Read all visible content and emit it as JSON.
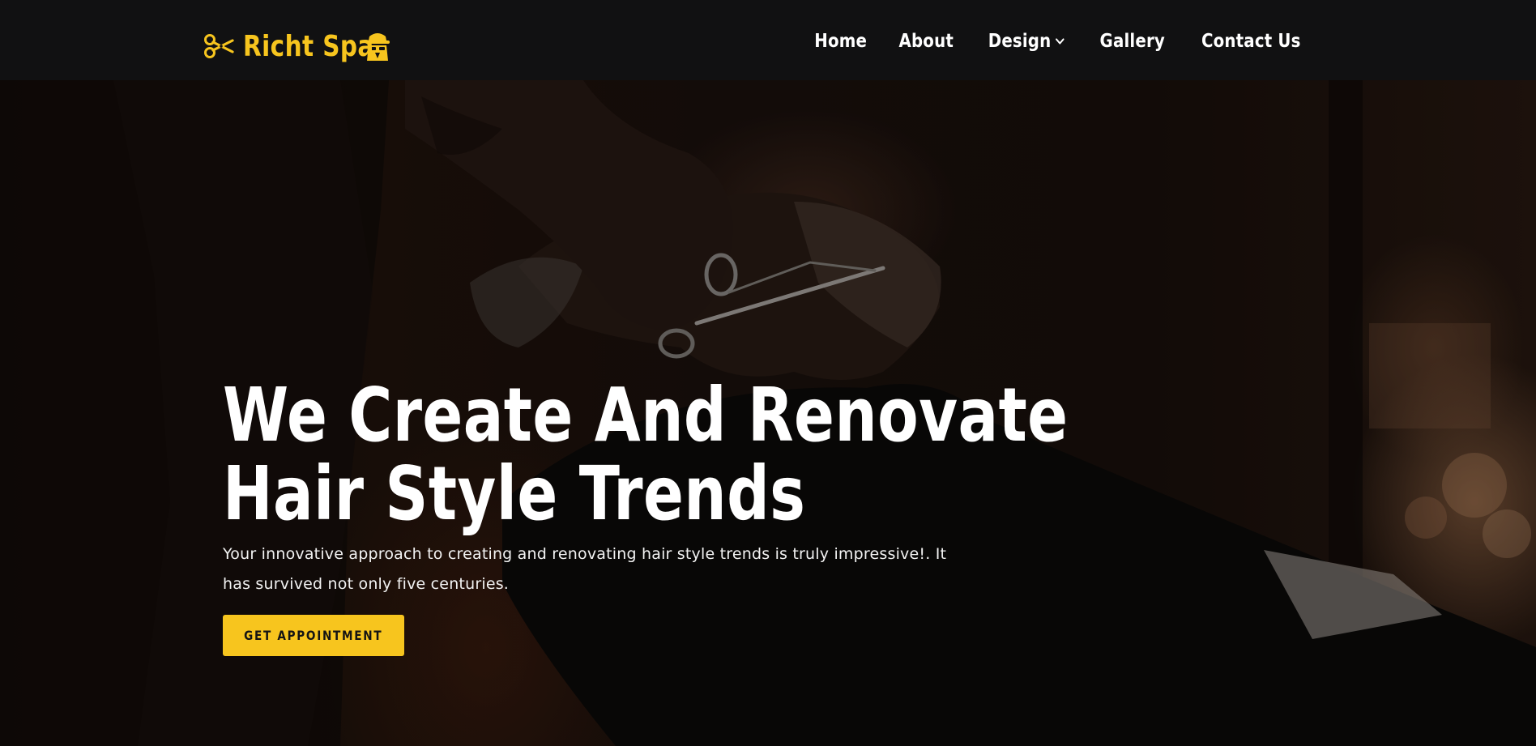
{
  "header": {
    "brand_name": "Richt Spa",
    "brand_icon": "scissors-icon",
    "brand_mascot_icon": "spy-mascot-icon",
    "accent_color": "#f7c51e",
    "nav": [
      {
        "label": "Home"
      },
      {
        "label": "About"
      },
      {
        "label": "Design",
        "has_dropdown": true
      },
      {
        "label": "Gallery"
      },
      {
        "label": "Contact Us"
      }
    ]
  },
  "hero": {
    "title_line1": "We Create And Renovate",
    "title_line2": "Hair Style Trends",
    "description": "Your innovative approach to creating and renovating hair style trends is truly impressive!. It has survived not only five centuries.",
    "cta_label": "GET APPOINTMENT",
    "background_image": "barber trimming a customer's beard with scissors"
  }
}
